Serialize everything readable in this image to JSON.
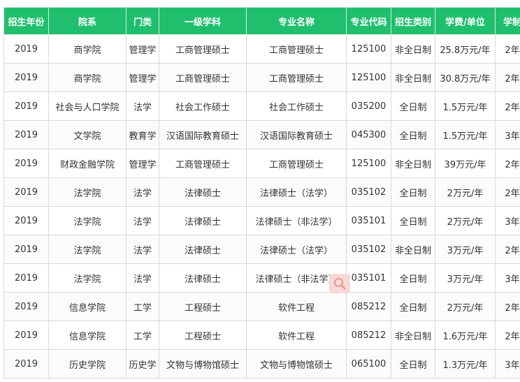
{
  "table": {
    "headers": [
      "招生年份",
      "院系",
      "门类",
      "一级学科",
      "专业名称",
      "专业代码",
      "招生类别",
      "学费/单位",
      "学制"
    ],
    "rows": [
      [
        "2019",
        "商学院",
        "管理学",
        "工商管理硕士",
        "工商管理硕士",
        "125100",
        "非全日制",
        "25.8万元/年",
        "2年"
      ],
      [
        "2019",
        "商学院",
        "管理学",
        "工商管理硕士",
        "工商管理硕士",
        "125100",
        "非全日制",
        "30.8万元/年",
        "2年"
      ],
      [
        "2019",
        "社会与人口学院",
        "法学",
        "社会工作硕士",
        "社会工作硕士",
        "035200",
        "全日制",
        "1.5万元/年",
        "2年"
      ],
      [
        "2019",
        "文学院",
        "教育学",
        "汉语国际教育硕士",
        "汉语国际教育硕士",
        "045300",
        "全日制",
        "1.5万元/年",
        "3年"
      ],
      [
        "2019",
        "财政金融学院",
        "管理学",
        "工商管理硕士",
        "工商管理硕士",
        "125100",
        "非全日制",
        "39万元/年",
        "2年"
      ],
      [
        "2019",
        "法学院",
        "法学",
        "法律硕士",
        "法律硕士（法学）",
        "035102",
        "全日制",
        "2万元/年",
        "2年"
      ],
      [
        "2019",
        "法学院",
        "法学",
        "法律硕士",
        "法律硕士（非法学）",
        "035101",
        "全日制",
        "2万元/年",
        "3年"
      ],
      [
        "2019",
        "法学院",
        "法学",
        "法律硕士",
        "法律硕士（法学）",
        "035102",
        "非全日制",
        "3万元/年",
        "2年"
      ],
      [
        "2019",
        "法学院",
        "法学",
        "法律硕士",
        "法律硕士（非法学）",
        "035101",
        "全日制",
        "3万元/年",
        "3年"
      ],
      [
        "2019",
        "信息学院",
        "工学",
        "工程硕士",
        "软件工程",
        "085212",
        "全日制",
        "2万元/年",
        "2年"
      ],
      [
        "2019",
        "信息学院",
        "工学",
        "工程硕士",
        "软件工程",
        "085212",
        "非全日制",
        "1.6万元/年",
        "2年"
      ],
      [
        "2019",
        "历史学院",
        "历史学",
        "文物与博物馆硕士",
        "文物与博物馆硕士",
        "065100",
        "全日制",
        "1.3万元/年",
        "3年"
      ]
    ]
  },
  "overlay": {
    "icon": "search-icon",
    "color": "#e7908c",
    "background": "#f7d7d6"
  },
  "colors": {
    "header_bg": "#1fbf6e",
    "header_text": "#ffffff",
    "cell_text": "#333333",
    "border": "#d9d9d9"
  }
}
